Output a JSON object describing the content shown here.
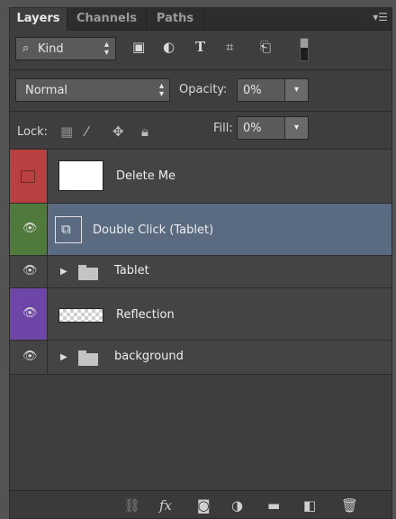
{
  "tabs": [
    {
      "label": "Layers",
      "active": true
    },
    {
      "label": "Channels",
      "active": false
    },
    {
      "label": "Paths",
      "active": false
    }
  ],
  "filter": {
    "kind_label": "Kind"
  },
  "blend": {
    "mode": "Normal",
    "opacity_label": "Opacity:",
    "opacity_value": "0%"
  },
  "lock": {
    "label": "Lock:",
    "fill_label": "Fill:",
    "fill_value": "0%"
  },
  "layers": [
    {
      "name": "Delete Me",
      "visible": false,
      "color": "#b84040",
      "thumb": "white"
    },
    {
      "name": "Double Click (Tablet)",
      "visible": true,
      "color": "#4f7a3c",
      "thumb": "smart-object",
      "selected": true
    },
    {
      "name": "Tablet",
      "visible": true,
      "color": "none",
      "thumb": "folder"
    },
    {
      "name": "Reflection",
      "visible": true,
      "color": "#6e46a8",
      "thumb": "transparent"
    },
    {
      "name": "background",
      "visible": true,
      "color": "none",
      "thumb": "folder"
    }
  ],
  "colors": {
    "panel": "#3e3e3e",
    "selected": "#5a6a80",
    "red_tag": "#b84040",
    "green_tag": "#4f7a3c",
    "violet_tag": "#6e46a8"
  }
}
